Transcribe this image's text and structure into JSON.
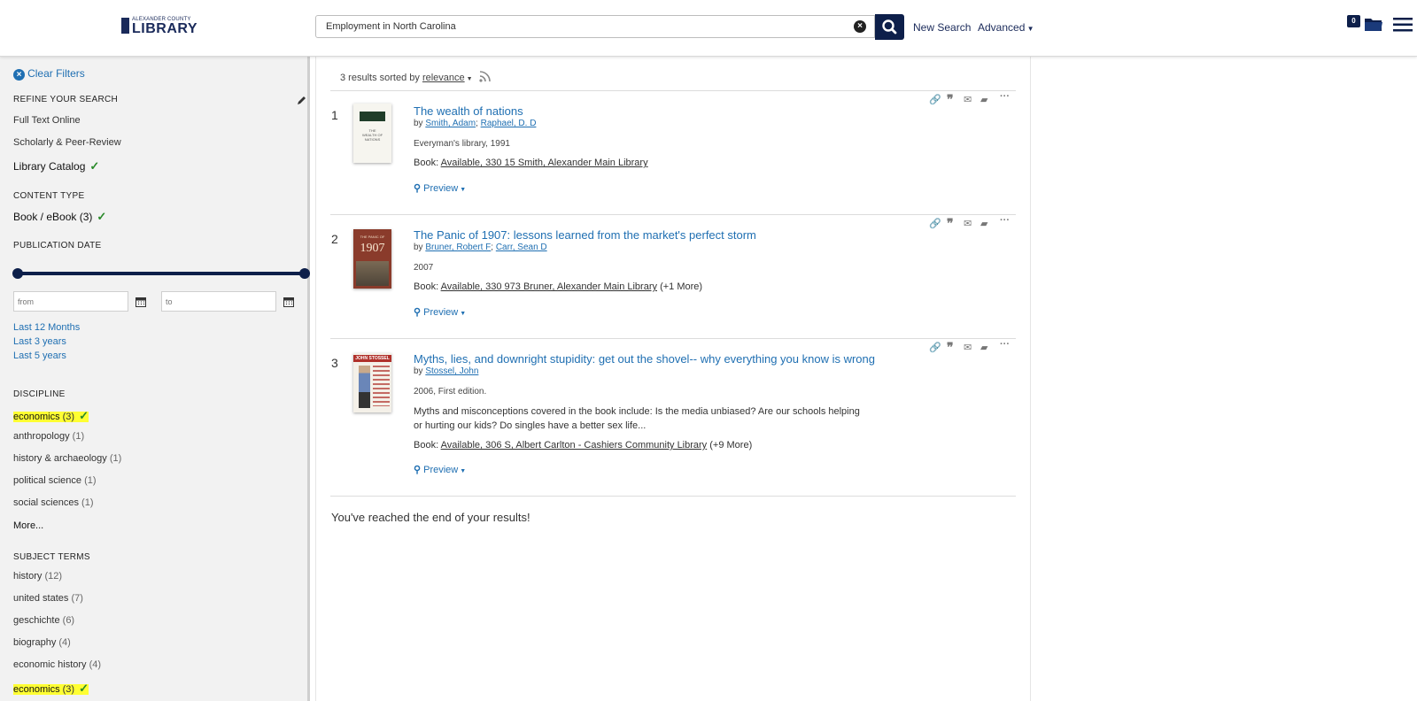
{
  "header": {
    "logo_small": "ALEXANDER COUNTY",
    "logo_big": "LIBRARY",
    "search_value": "Employment in North Carolina",
    "new_search": "New Search",
    "advanced": "Advanced",
    "cart_count": "0"
  },
  "sidebar": {
    "clear_filters": "Clear Filters",
    "refine": {
      "heading": "REFINE YOUR SEARCH",
      "items": [
        "Full Text Online",
        "Scholarly & Peer-Review",
        "Library Catalog"
      ]
    },
    "content_type": {
      "heading": "CONTENT TYPE",
      "item": "Book / eBook",
      "count": "(3)"
    },
    "publication_date": {
      "heading": "PUBLICATION DATE",
      "from_placeholder": "from",
      "to_placeholder": "to",
      "links": [
        "Last 12 Months",
        "Last 3 years",
        "Last 5 years"
      ]
    },
    "discipline": {
      "heading": "DISCIPLINE",
      "items": [
        {
          "label": "economics",
          "count": "(3)"
        },
        {
          "label": "anthropology",
          "count": "(1)"
        },
        {
          "label": "history & archaeology",
          "count": "(1)"
        },
        {
          "label": "political science",
          "count": "(1)"
        },
        {
          "label": "social sciences",
          "count": "(1)"
        }
      ],
      "more": "More..."
    },
    "subject_terms": {
      "heading": "SUBJECT TERMS",
      "items": [
        {
          "label": "history",
          "count": "(12)"
        },
        {
          "label": "united states",
          "count": "(7)"
        },
        {
          "label": "geschichte",
          "count": "(6)"
        },
        {
          "label": "biography",
          "count": "(4)"
        },
        {
          "label": "economic history",
          "count": "(4)"
        },
        {
          "label": "economics",
          "count": "(3)"
        }
      ]
    }
  },
  "results": {
    "count_text": "3 results sorted by",
    "sort": "relevance",
    "items": [
      {
        "num": "1",
        "title": "The wealth of nations",
        "by": "by",
        "authors": [
          "Smith, Adam",
          "Raphael, D. D"
        ],
        "edition": "Everyman's library, 1991",
        "format": "Book:",
        "availability": "Available, 330 15 Smith, Alexander Main Library",
        "more": "",
        "preview": "Preview",
        "cover_lines": [
          "THE",
          "WEALTH OF",
          "NATIONS"
        ]
      },
      {
        "num": "2",
        "title": "The Panic of 1907: lessons learned from the market's perfect storm",
        "by": "by",
        "authors": [
          "Bruner, Robert F",
          "Carr, Sean D"
        ],
        "edition": "2007",
        "format": "Book:",
        "availability": "Available, 330 973 Bruner, Alexander Main Library",
        "more": "(+1 More)",
        "preview": "Preview",
        "cover_lines": [
          "THE PANIC OF",
          "1907"
        ]
      },
      {
        "num": "3",
        "title": "Myths, lies, and downright stupidity: get out the shovel-- why everything you know is wrong",
        "by": "by",
        "authors": [
          "Stossel, John"
        ],
        "edition": "2006, First edition.",
        "description_1": "Myths and misconceptions covered in the book include: Is the media unbiased? Are our schools helping",
        "description_2": "or hurting our kids? Do singles have a better sex life...",
        "format": "Book:",
        "availability": "Available, 306 S, Albert Carlton - Cashiers Community Library",
        "more": "(+9 More)",
        "preview": "Preview",
        "cover_lines": [
          "JOHN STOSSEL"
        ]
      }
    ],
    "end_text": "You've reached the end of your results!"
  },
  "colors": {
    "brand": "#0d1f4a",
    "link": "#1f6fb2",
    "highlight": "#ffff33",
    "check": "#2a8a2a"
  }
}
